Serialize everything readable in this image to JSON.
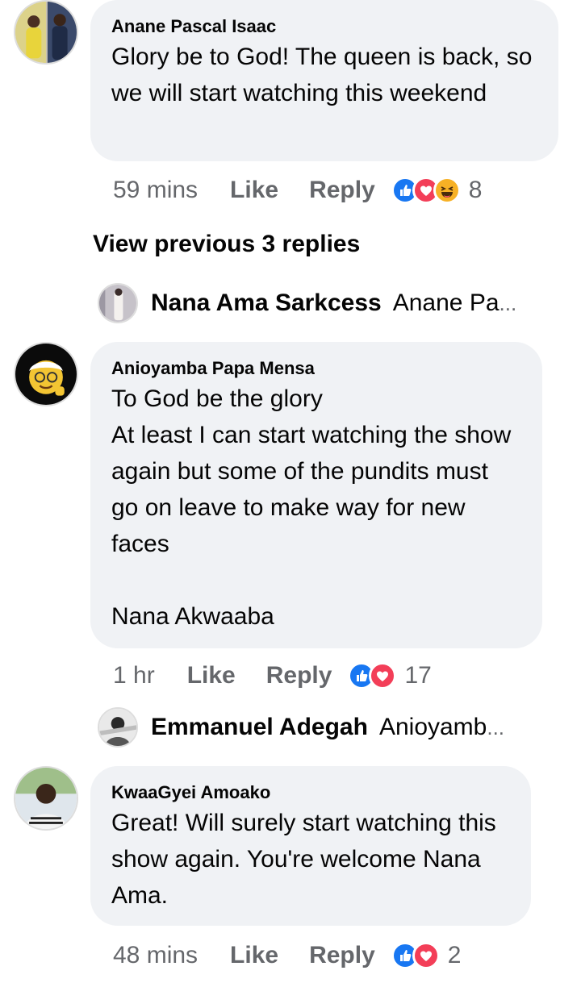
{
  "comments": [
    {
      "author": "Anane Pascal Isaac",
      "text": "Glory be to God! The queen is back, so we will start watching this weekend",
      "time": "59 mins",
      "like": "Like",
      "reply": "Reply",
      "reactions": [
        "like-icon",
        "love-icon",
        "haha-icon"
      ],
      "reaction_count": "8"
    },
    {
      "author": "Anioyamba Papa Mensa",
      "text": "To God be the glory\nAt least I can start watching the show again  but some of the pundits must go on leave to make way for new faces\n\nNana Akwaaba",
      "time": "1 hr",
      "like": "Like",
      "reply": "Reply",
      "reactions": [
        "like-icon",
        "love-icon"
      ],
      "reaction_count": "17"
    },
    {
      "author": "KwaaGyei Amoako",
      "text": "Great! Will surely start watching this show again. You're welcome Nana Ama.",
      "time": "48 mins",
      "like": "Like",
      "reply": "Reply",
      "reactions": [
        "like-icon",
        "love-icon"
      ],
      "reaction_count": "2"
    }
  ],
  "view_previous": "View previous 3 replies",
  "replies": [
    {
      "name": "Nana Ama Sarkcess",
      "preview": "Anane Pa",
      "ellipsis": "..."
    },
    {
      "name": "Emmanuel Adegah",
      "preview": "Anioyamb",
      "ellipsis": "..."
    }
  ],
  "colors": {
    "bubble": "#f0f2f5",
    "meta_text": "#65676b",
    "like_blue": "#1877f2",
    "love_red": "#f33e58",
    "haha_yellow": "#f7b125"
  }
}
